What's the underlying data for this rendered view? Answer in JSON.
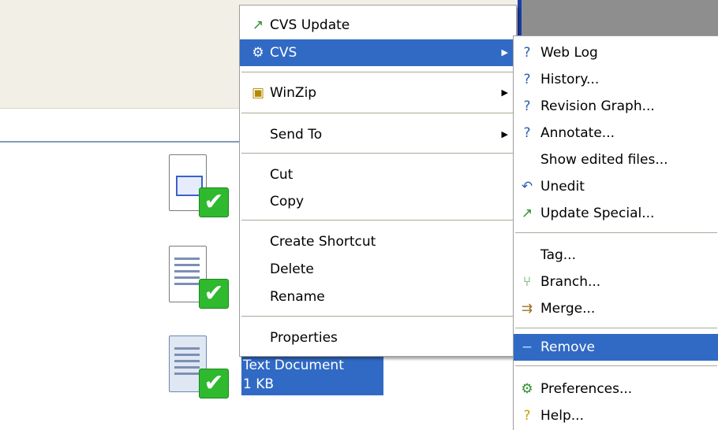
{
  "context_menu": {
    "items": {
      "cvs_update": "CVS Update",
      "cvs": "CVS",
      "winzip": "WinZip",
      "send_to": "Send To",
      "cut": "Cut",
      "copy": "Copy",
      "create_shortcut": "Create Shortcut",
      "delete": "Delete",
      "rename": "Rename",
      "properties": "Properties"
    }
  },
  "cvs_submenu": {
    "items": {
      "web_log": "Web Log",
      "history": "History...",
      "revision_graph": "Revision Graph...",
      "annotate": "Annotate...",
      "show_edited": "Show edited files...",
      "unedit": "Unedit",
      "update_special": "Update Special...",
      "tag": "Tag...",
      "branch": "Branch...",
      "merge": "Merge...",
      "remove": "Remove",
      "preferences": "Preferences...",
      "help": "Help..."
    },
    "highlighted": "Remove"
  },
  "files": {
    "selected_name": "Text Document",
    "selected_size": "1 KB"
  },
  "icons": {
    "check": "✔",
    "submenu_arrow": "▶"
  },
  "colors": {
    "highlight": "#316ac5",
    "status_ok": "#2fb92f"
  }
}
